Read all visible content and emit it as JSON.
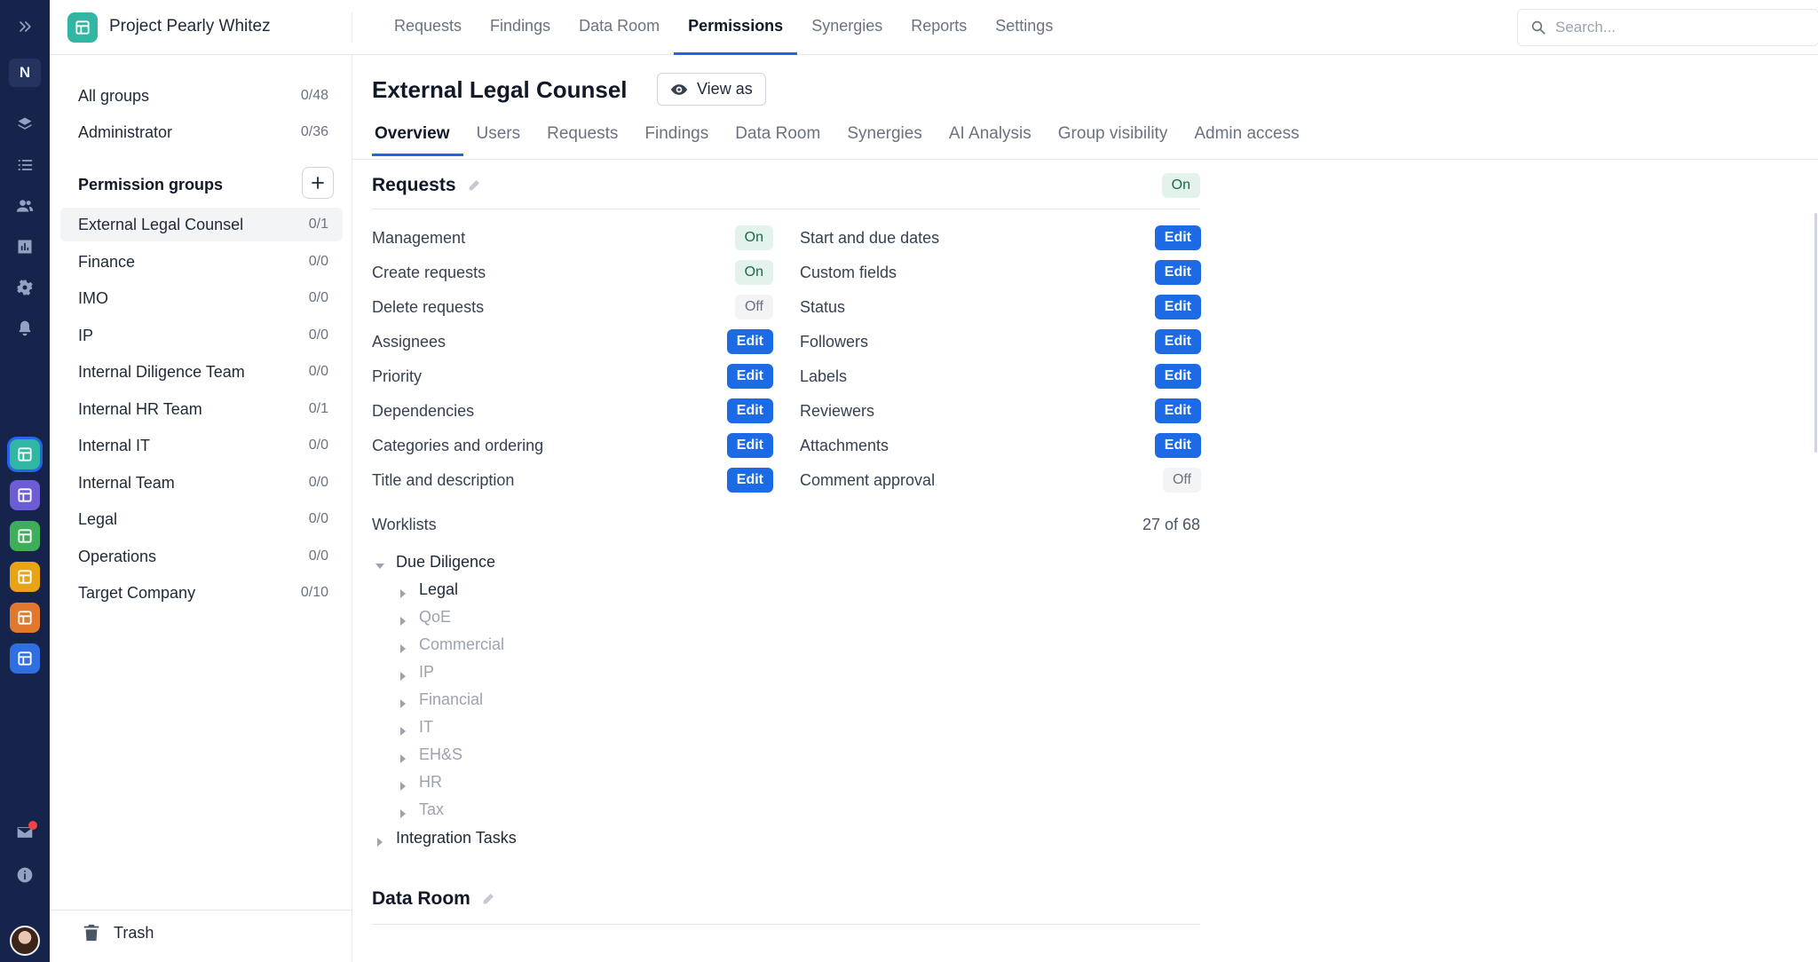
{
  "app": {
    "project_name": "Project Pearly Whitez",
    "brand_color": "#31b6a4",
    "accent_color": "#1d6ae5"
  },
  "rail": {
    "workspace_letter": "N",
    "icons": [
      "expand-chevrons-icon",
      "layers-icon",
      "list-icon",
      "users-icon",
      "chart-icon",
      "gear-icon",
      "bell-icon",
      "mail-icon",
      "info-icon"
    ],
    "project_colors": [
      "#31b6a4",
      "#6d5dd3",
      "#3fae5a",
      "#e8a317",
      "#e0782e",
      "#2f6fe0"
    ]
  },
  "topnav": {
    "items": [
      "Requests",
      "Findings",
      "Data Room",
      "Permissions",
      "Synergies",
      "Reports",
      "Settings"
    ],
    "active": "Permissions"
  },
  "search": {
    "placeholder": "Search..."
  },
  "groups": {
    "fixed": [
      {
        "label": "All groups",
        "count": "0/48"
      },
      {
        "label": "Administrator",
        "count": "0/36"
      }
    ],
    "heading": "Permission groups",
    "items": [
      {
        "label": "External Legal Counsel",
        "count": "0/1"
      },
      {
        "label": "Finance",
        "count": "0/0"
      },
      {
        "label": "IMO",
        "count": "0/0"
      },
      {
        "label": "IP",
        "count": "0/0"
      },
      {
        "label": "Internal Diligence Team",
        "count": "0/0"
      },
      {
        "label": "Internal HR Team",
        "count": "0/1"
      },
      {
        "label": "Internal IT",
        "count": "0/0"
      },
      {
        "label": "Internal Team",
        "count": "0/0"
      },
      {
        "label": "Legal",
        "count": "0/0"
      },
      {
        "label": "Operations",
        "count": "0/0"
      },
      {
        "label": "Target Company",
        "count": "0/10"
      }
    ],
    "trash_label": "Trash"
  },
  "main": {
    "title": "External Legal Counsel",
    "view_as_label": "View as",
    "tabs": [
      "Overview",
      "Users",
      "Requests",
      "Findings",
      "Data Room",
      "Synergies",
      "AI Analysis",
      "Group visibility",
      "Admin access"
    ],
    "active_tab": "Overview",
    "requests": {
      "title": "Requests",
      "status": "On",
      "left": [
        {
          "label": "Management",
          "value": "On"
        },
        {
          "label": "Create requests",
          "value": "On"
        },
        {
          "label": "Delete requests",
          "value": "Off"
        },
        {
          "label": "Assignees",
          "value": "Edit"
        },
        {
          "label": "Priority",
          "value": "Edit"
        },
        {
          "label": "Dependencies",
          "value": "Edit"
        },
        {
          "label": "Categories and ordering",
          "value": "Edit"
        },
        {
          "label": "Title and description",
          "value": "Edit"
        }
      ],
      "right": [
        {
          "label": "Start and due dates",
          "value": "Edit"
        },
        {
          "label": "Custom fields",
          "value": "Edit"
        },
        {
          "label": "Status",
          "value": "Edit"
        },
        {
          "label": "Followers",
          "value": "Edit"
        },
        {
          "label": "Labels",
          "value": "Edit"
        },
        {
          "label": "Reviewers",
          "value": "Edit"
        },
        {
          "label": "Attachments",
          "value": "Edit"
        },
        {
          "label": "Comment approval",
          "value": "Off"
        }
      ],
      "worklists_label": "Worklists",
      "worklists_count": "27 of 68",
      "tree": {
        "root": "Due Diligence",
        "children": [
          {
            "label": "Legal",
            "enabled": true
          },
          {
            "label": "QoE",
            "enabled": false
          },
          {
            "label": "Commercial",
            "enabled": false
          },
          {
            "label": "IP",
            "enabled": false
          },
          {
            "label": "Financial",
            "enabled": false
          },
          {
            "label": "IT",
            "enabled": false
          },
          {
            "label": "EH&S",
            "enabled": false
          },
          {
            "label": "HR",
            "enabled": false
          },
          {
            "label": "Tax",
            "enabled": false
          }
        ],
        "second_root": "Integration Tasks"
      }
    },
    "data_room": {
      "title": "Data Room"
    }
  }
}
